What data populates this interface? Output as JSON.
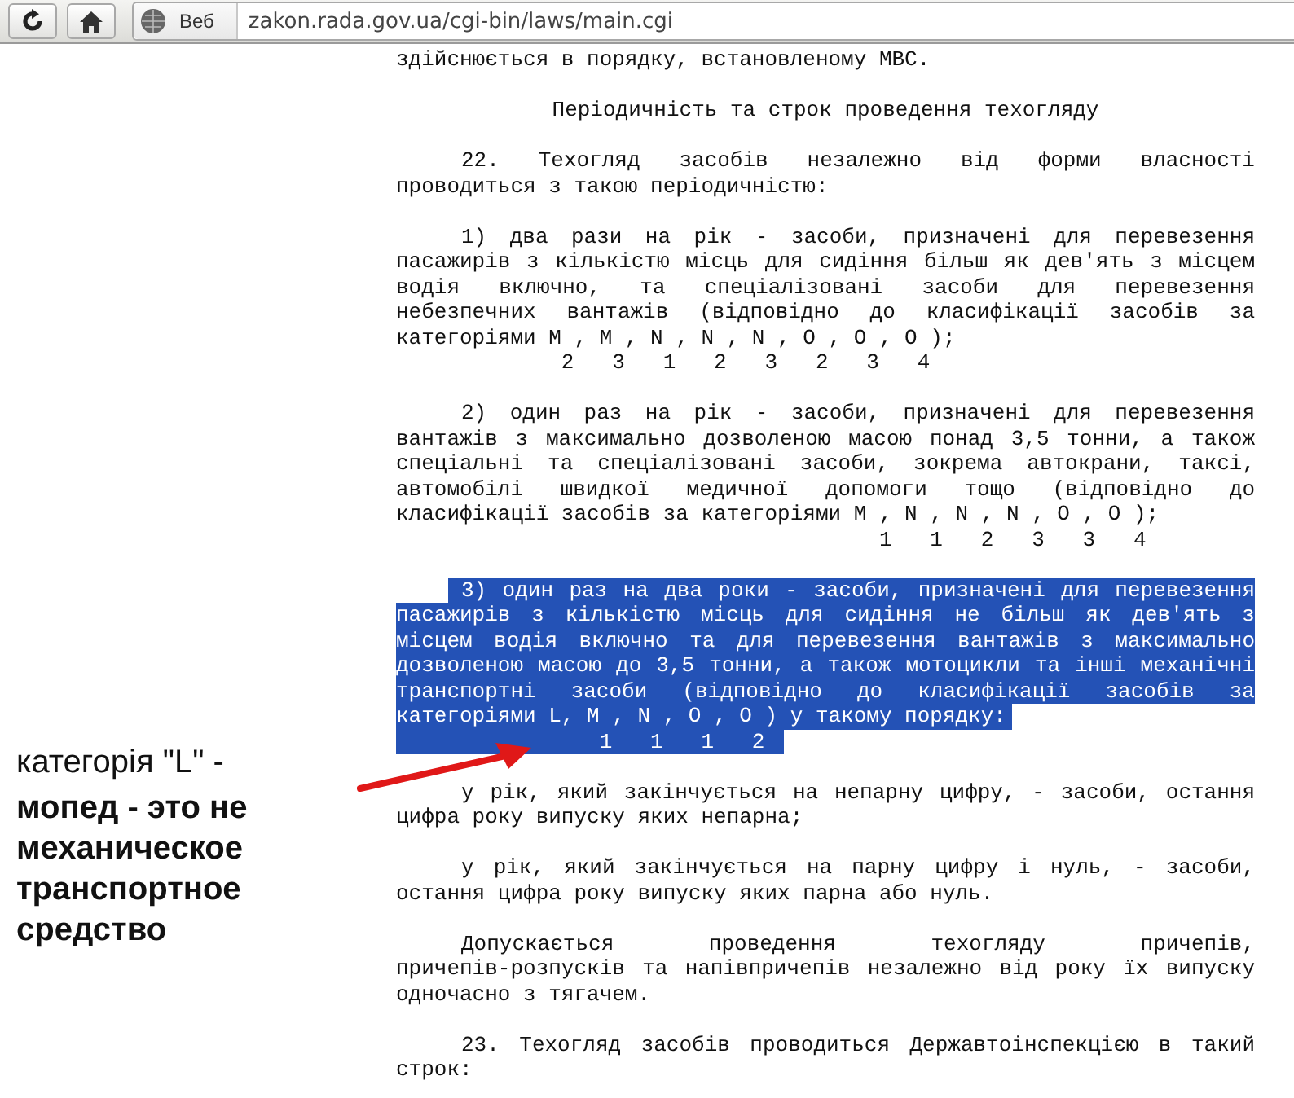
{
  "toolbar": {
    "zone_label": "Веб",
    "url": "zakon.rada.gov.ua/cgi-bin/laws/main.cgi"
  },
  "document": {
    "blocks": [
      {
        "kind": "paragraph",
        "indent": false,
        "highlighted": false,
        "lines": [
          "здійснюється в порядку, встановленому МВС."
        ]
      },
      {
        "kind": "heading",
        "text": "Періодичність та строк проведення техогляду"
      },
      {
        "kind": "paragraph",
        "indent": true,
        "highlighted": false,
        "lines": [
          "22. Техогляд  засобів  незалежно  від  форми  власності",
          "проводиться з такою періодичністю:"
        ]
      },
      {
        "kind": "paragraph",
        "indent": true,
        "highlighted": false,
        "lines": [
          "1) два рази на  рік  -  засоби,  призначені  для  перевезення",
          "пасажирів  з кількістю місць для сидіння більш як дев'ять з місцем",
          "водія  включно,  та  спеціалізовані  засоби  для  перевезення",
          "небезпечних  вантажів  (відповідно  до  класифікації  засобів  за",
          "категоріями M , M , N , N , N , O , O , O );"
        ]
      },
      {
        "kind": "indices",
        "highlighted": false,
        "text": "             2   3   1   2   3   2   3   4"
      },
      {
        "kind": "paragraph",
        "indent": true,
        "highlighted": false,
        "lines": [
          "2) один  раз  на  рік  -  засоби,  призначені для перевезення",
          "вантажів з максимально дозволеною масою понад 3,5 тонни,  а  також",
          "спеціальні  та  спеціалізовані засоби,  зокрема автокрани,  таксі,",
          "автомобілі  швидкої  медичної  допомоги  тощо  (відповідно  до",
          "класифікації засобів за категоріями M , N , N , N , O , O );"
        ]
      },
      {
        "kind": "indices",
        "highlighted": false,
        "text": "                                      1   1   2   3   3   4"
      },
      {
        "kind": "paragraph",
        "indent": true,
        "highlighted": true,
        "lines": [
          "3) один раз на два роки - засоби,  призначені для перевезення",
          "пасажирів  з  кількістю  місць  для  сидіння не більш як дев'ять з",
          "місцем водія включно та для  перевезення  вантажів  з  максимально",
          "дозволеною масою до 3,5 тонни, а також мотоцикли та інші механічні",
          "транспортні  засоби  (відповідно  до  класифікації  засобів  за",
          "категоріями L, M , N , O , O ) у такому порядку:"
        ]
      },
      {
        "kind": "indices",
        "highlighted": true,
        "text": "                1   1   1   2"
      },
      {
        "kind": "paragraph",
        "indent": true,
        "highlighted": false,
        "lines": [
          "у рік,  який закінчується на непарну цифру, - засоби, остання",
          "цифра року випуску яких непарна;"
        ]
      },
      {
        "kind": "paragraph",
        "indent": true,
        "highlighted": false,
        "lines": [
          "у рік,  який  закінчується  на парну цифру і нуль,  - засоби,",
          "остання цифра року випуску яких парна або нуль."
        ]
      },
      {
        "kind": "paragraph",
        "indent": true,
        "highlighted": false,
        "lines": [
          "Допускається проведення        техогляду        причепів,",
          "причепів-розпусків  та напівпричепів незалежно від року їх випуску",
          "одночасно з тягачем."
        ]
      },
      {
        "kind": "paragraph",
        "indent": true,
        "highlighted": false,
        "lines": [
          "23. Техогляд засобів проводиться Державтоінспекцією  в  такий",
          "строк:"
        ]
      }
    ]
  },
  "annotation": {
    "caption": "категорія \"L\" -",
    "note": "мопед - это не механическое транспортное средство"
  }
}
